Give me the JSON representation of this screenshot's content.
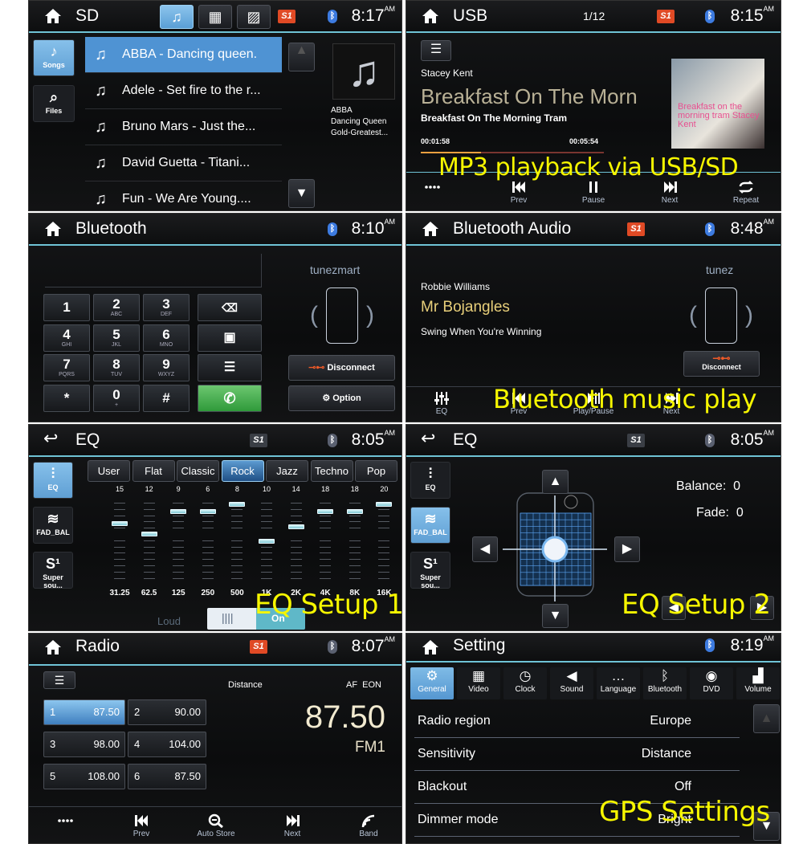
{
  "colors": {
    "accent_blue": "#4f93d3",
    "header_line": "#6fc3d6",
    "s1_red": "#e04a25",
    "overlay_yellow": "#f6f600",
    "call_green": "#3fa84a"
  },
  "sd": {
    "title": "SD",
    "time": "8:17",
    "ampm": "AM",
    "s1": "S1",
    "tabs": [
      {
        "icon": "music-icon",
        "active": true
      },
      {
        "icon": "video-icon"
      },
      {
        "icon": "picture-icon"
      }
    ],
    "side": [
      {
        "label": "Songs",
        "icon": "music-note-icon",
        "active": true
      },
      {
        "label": "Files",
        "icon": "search-folder-icon"
      }
    ],
    "songs": [
      "ABBA - Dancing queen.",
      "Adele - Set fire to the r...",
      "Bruno Mars - Just the...",
      "David Guetta - Titani...",
      "Fun - We Are Young...."
    ],
    "now_playing": {
      "artist": "ABBA",
      "title": "Dancing Queen",
      "album": "Gold-Greatest..."
    }
  },
  "usb": {
    "title": "USB",
    "track_count": "1/12",
    "time": "8:15",
    "ampm": "AM",
    "s1": "S1",
    "artist": "Stacey Kent",
    "song_big": "Breakfast On The Morn",
    "album": "Breakfast On The Morning Tram",
    "elapsed": "00:01:58",
    "total": "00:05:54",
    "progress": 0.33,
    "album_art_text": "Breakfast on the morning tram Stacey Kent",
    "controls": [
      {
        "icon": "more-dots-icon",
        "label": ""
      },
      {
        "icon": "prev-icon",
        "label": "Prev"
      },
      {
        "icon": "pause-icon",
        "label": "Pause"
      },
      {
        "icon": "next-icon",
        "label": "Next"
      },
      {
        "icon": "repeat-icon",
        "label": "Repeat"
      }
    ],
    "overlay": "MP3 playback via USB/SD"
  },
  "bt": {
    "title": "Bluetooth",
    "time": "8:10",
    "ampm": "AM",
    "device": "tunezmart",
    "dialed": "",
    "keys": [
      {
        "d": "1",
        "l": ""
      },
      {
        "d": "2",
        "l": "ABC"
      },
      {
        "d": "3",
        "l": "DEF"
      },
      {
        "d": "4",
        "l": "GHI"
      },
      {
        "d": "5",
        "l": "JKL"
      },
      {
        "d": "6",
        "l": "MNO"
      },
      {
        "d": "7",
        "l": "PQRS"
      },
      {
        "d": "8",
        "l": "TUV"
      },
      {
        "d": "9",
        "l": "WXYZ"
      },
      {
        "d": "*",
        "l": ""
      },
      {
        "d": "0",
        "l": "+"
      },
      {
        "d": "#",
        "l": ""
      }
    ],
    "disconnect": "Disconnect",
    "option": "Option"
  },
  "bta": {
    "title": "Bluetooth Audio",
    "time": "8:48",
    "ampm": "AM",
    "s1": "S1",
    "artist": "Robbie Williams",
    "song": "Mr Bojangles",
    "album": "Swing When You're Winning",
    "device": "tunez",
    "disconnect": "Disconnect",
    "controls": [
      {
        "icon": "eq-icon",
        "label": "EQ"
      },
      {
        "icon": "prev-icon",
        "label": "Prev"
      },
      {
        "icon": "play-pause-icon",
        "label": "Play/Pause"
      },
      {
        "icon": "next-icon",
        "label": "Next"
      }
    ],
    "overlay": "Bluetooth music play"
  },
  "eq1": {
    "title": "EQ",
    "time": "8:05",
    "ampm": "AM",
    "s1": "S1",
    "side": [
      {
        "label": "EQ",
        "active": true
      },
      {
        "label": "FAD_BAL"
      },
      {
        "label": "Super sou..."
      }
    ],
    "presets": [
      "User",
      "Flat",
      "Classic",
      "Rock",
      "Jazz",
      "Techno",
      "Pop"
    ],
    "active_preset": "Rock",
    "values": [
      "15",
      "12",
      "9",
      "6",
      "8",
      "10",
      "14",
      "18",
      "18",
      "20"
    ],
    "bands": [
      "31.25",
      "62.5",
      "125",
      "250",
      "500",
      "1K",
      "2K",
      "4K",
      "8K",
      "16K"
    ],
    "slider_levels": [
      0.73,
      0.59,
      0.88,
      0.88,
      0.98,
      0.49,
      0.68,
      0.88,
      0.88,
      0.98
    ],
    "loud_label": "Loud",
    "loud_state": "On",
    "overlay": "EQ Setup 1"
  },
  "eq2": {
    "title": "EQ",
    "time": "8:05",
    "ampm": "AM",
    "s1": "S1",
    "side": [
      {
        "label": "EQ"
      },
      {
        "label": "FAD_BAL",
        "active": true
      },
      {
        "label": "Super sou..."
      }
    ],
    "balance_label": "Balance:",
    "balance": "0",
    "fade_label": "Fade:",
    "fade": "0",
    "overlay": "EQ Setup 2"
  },
  "radio": {
    "title": "Radio",
    "time": "8:07",
    "ampm": "AM",
    "s1": "S1",
    "sensitivity": "Distance",
    "flags": "AF  EON",
    "frequency": "87.50",
    "band": "FM1",
    "presets": [
      {
        "n": "1",
        "f": "87.50",
        "active": true
      },
      {
        "n": "2",
        "f": "90.00"
      },
      {
        "n": "3",
        "f": "98.00"
      },
      {
        "n": "4",
        "f": "104.00"
      },
      {
        "n": "5",
        "f": "108.00"
      },
      {
        "n": "6",
        "f": "87.50"
      }
    ],
    "controls": [
      {
        "icon": "more-dots-icon",
        "label": ""
      },
      {
        "icon": "prev-icon",
        "label": "Prev"
      },
      {
        "icon": "auto-store-icon",
        "label": "Auto Store"
      },
      {
        "icon": "next-icon",
        "label": "Next"
      },
      {
        "icon": "band-icon",
        "label": "Band"
      }
    ]
  },
  "setting": {
    "title": "Setting",
    "time": "8:19",
    "ampm": "AM",
    "tabs": [
      {
        "label": "General",
        "icon": "gear-icon",
        "g": "⚙",
        "active": true
      },
      {
        "label": "Video",
        "icon": "film-icon",
        "g": "▦"
      },
      {
        "label": "Clock",
        "icon": "clock-icon",
        "g": "◷"
      },
      {
        "label": "Sound",
        "icon": "speaker-icon",
        "g": "◀"
      },
      {
        "label": "Language",
        "icon": "chat-icon",
        "g": "…"
      },
      {
        "label": "Bluetooth",
        "icon": "bluetooth-icon",
        "g": "ᛒ"
      },
      {
        "label": "DVD",
        "icon": "disc-icon",
        "g": "◉"
      },
      {
        "label": "Volume",
        "icon": "volume-bars-icon",
        "g": "▟"
      }
    ],
    "rows": [
      {
        "k": "Radio region",
        "v": "Europe"
      },
      {
        "k": "Sensitivity",
        "v": "Distance"
      },
      {
        "k": "Blackout",
        "v": "Off"
      },
      {
        "k": "Dimmer mode",
        "v": "Bright"
      }
    ],
    "overlay": "GPS Settings"
  }
}
